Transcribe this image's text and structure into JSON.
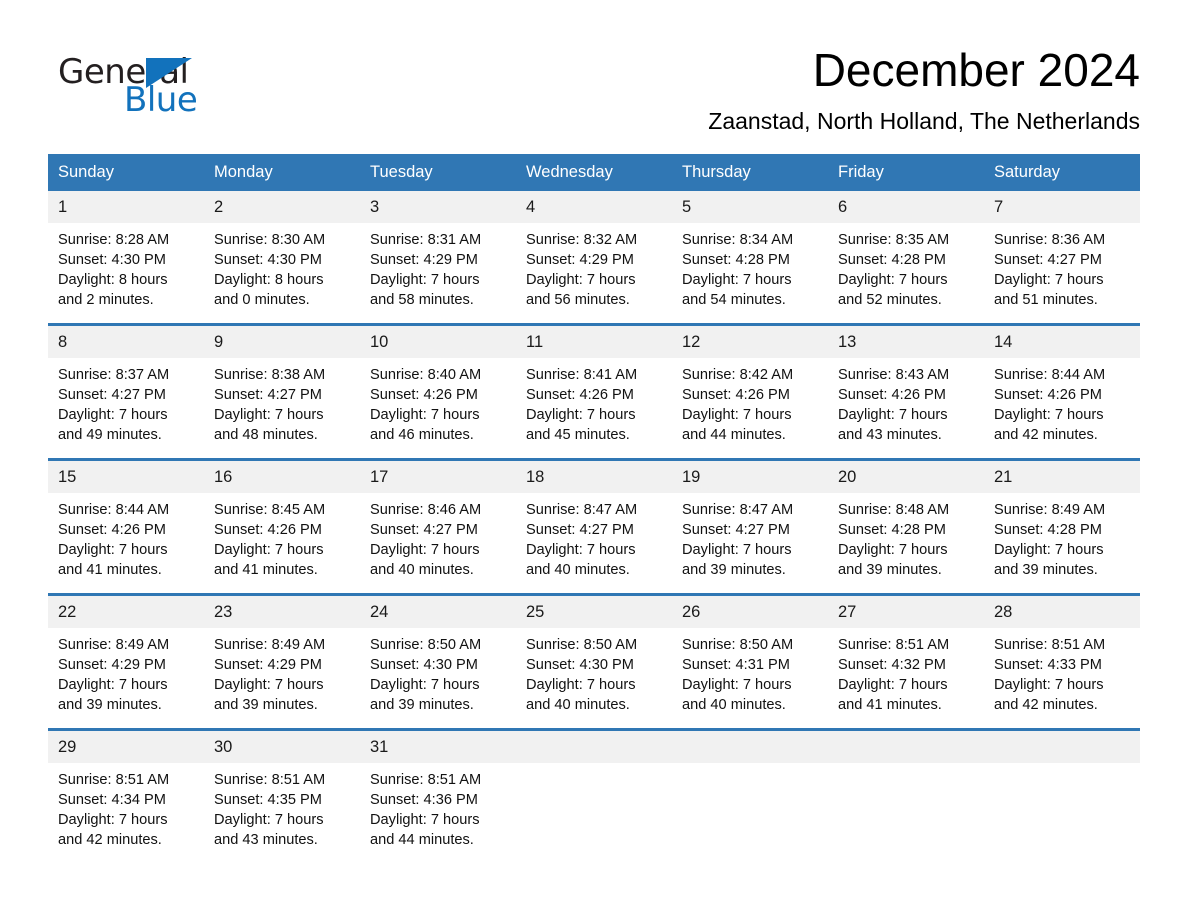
{
  "brand": {
    "name_part1": "General",
    "name_part2": "Blue",
    "triangle_color": "#1272bc"
  },
  "header": {
    "month_title": "December 2024",
    "location": "Zaanstad, North Holland, The Netherlands",
    "header_bg_color": "#3077b4",
    "daynum_bg_color": "#f1f1f1"
  },
  "weekdays": [
    "Sunday",
    "Monday",
    "Tuesday",
    "Wednesday",
    "Thursday",
    "Friday",
    "Saturday"
  ],
  "weeks": [
    [
      {
        "day": "1",
        "sunrise": "Sunrise: 8:28 AM",
        "sunset": "Sunset: 4:30 PM",
        "daylight_1": "Daylight: 8 hours",
        "daylight_2": "and 2 minutes."
      },
      {
        "day": "2",
        "sunrise": "Sunrise: 8:30 AM",
        "sunset": "Sunset: 4:30 PM",
        "daylight_1": "Daylight: 8 hours",
        "daylight_2": "and 0 minutes."
      },
      {
        "day": "3",
        "sunrise": "Sunrise: 8:31 AM",
        "sunset": "Sunset: 4:29 PM",
        "daylight_1": "Daylight: 7 hours",
        "daylight_2": "and 58 minutes."
      },
      {
        "day": "4",
        "sunrise": "Sunrise: 8:32 AM",
        "sunset": "Sunset: 4:29 PM",
        "daylight_1": "Daylight: 7 hours",
        "daylight_2": "and 56 minutes."
      },
      {
        "day": "5",
        "sunrise": "Sunrise: 8:34 AM",
        "sunset": "Sunset: 4:28 PM",
        "daylight_1": "Daylight: 7 hours",
        "daylight_2": "and 54 minutes."
      },
      {
        "day": "6",
        "sunrise": "Sunrise: 8:35 AM",
        "sunset": "Sunset: 4:28 PM",
        "daylight_1": "Daylight: 7 hours",
        "daylight_2": "and 52 minutes."
      },
      {
        "day": "7",
        "sunrise": "Sunrise: 8:36 AM",
        "sunset": "Sunset: 4:27 PM",
        "daylight_1": "Daylight: 7 hours",
        "daylight_2": "and 51 minutes."
      }
    ],
    [
      {
        "day": "8",
        "sunrise": "Sunrise: 8:37 AM",
        "sunset": "Sunset: 4:27 PM",
        "daylight_1": "Daylight: 7 hours",
        "daylight_2": "and 49 minutes."
      },
      {
        "day": "9",
        "sunrise": "Sunrise: 8:38 AM",
        "sunset": "Sunset: 4:27 PM",
        "daylight_1": "Daylight: 7 hours",
        "daylight_2": "and 48 minutes."
      },
      {
        "day": "10",
        "sunrise": "Sunrise: 8:40 AM",
        "sunset": "Sunset: 4:26 PM",
        "daylight_1": "Daylight: 7 hours",
        "daylight_2": "and 46 minutes."
      },
      {
        "day": "11",
        "sunrise": "Sunrise: 8:41 AM",
        "sunset": "Sunset: 4:26 PM",
        "daylight_1": "Daylight: 7 hours",
        "daylight_2": "and 45 minutes."
      },
      {
        "day": "12",
        "sunrise": "Sunrise: 8:42 AM",
        "sunset": "Sunset: 4:26 PM",
        "daylight_1": "Daylight: 7 hours",
        "daylight_2": "and 44 minutes."
      },
      {
        "day": "13",
        "sunrise": "Sunrise: 8:43 AM",
        "sunset": "Sunset: 4:26 PM",
        "daylight_1": "Daylight: 7 hours",
        "daylight_2": "and 43 minutes."
      },
      {
        "day": "14",
        "sunrise": "Sunrise: 8:44 AM",
        "sunset": "Sunset: 4:26 PM",
        "daylight_1": "Daylight: 7 hours",
        "daylight_2": "and 42 minutes."
      }
    ],
    [
      {
        "day": "15",
        "sunrise": "Sunrise: 8:44 AM",
        "sunset": "Sunset: 4:26 PM",
        "daylight_1": "Daylight: 7 hours",
        "daylight_2": "and 41 minutes."
      },
      {
        "day": "16",
        "sunrise": "Sunrise: 8:45 AM",
        "sunset": "Sunset: 4:26 PM",
        "daylight_1": "Daylight: 7 hours",
        "daylight_2": "and 41 minutes."
      },
      {
        "day": "17",
        "sunrise": "Sunrise: 8:46 AM",
        "sunset": "Sunset: 4:27 PM",
        "daylight_1": "Daylight: 7 hours",
        "daylight_2": "and 40 minutes."
      },
      {
        "day": "18",
        "sunrise": "Sunrise: 8:47 AM",
        "sunset": "Sunset: 4:27 PM",
        "daylight_1": "Daylight: 7 hours",
        "daylight_2": "and 40 minutes."
      },
      {
        "day": "19",
        "sunrise": "Sunrise: 8:47 AM",
        "sunset": "Sunset: 4:27 PM",
        "daylight_1": "Daylight: 7 hours",
        "daylight_2": "and 39 minutes."
      },
      {
        "day": "20",
        "sunrise": "Sunrise: 8:48 AM",
        "sunset": "Sunset: 4:28 PM",
        "daylight_1": "Daylight: 7 hours",
        "daylight_2": "and 39 minutes."
      },
      {
        "day": "21",
        "sunrise": "Sunrise: 8:49 AM",
        "sunset": "Sunset: 4:28 PM",
        "daylight_1": "Daylight: 7 hours",
        "daylight_2": "and 39 minutes."
      }
    ],
    [
      {
        "day": "22",
        "sunrise": "Sunrise: 8:49 AM",
        "sunset": "Sunset: 4:29 PM",
        "daylight_1": "Daylight: 7 hours",
        "daylight_2": "and 39 minutes."
      },
      {
        "day": "23",
        "sunrise": "Sunrise: 8:49 AM",
        "sunset": "Sunset: 4:29 PM",
        "daylight_1": "Daylight: 7 hours",
        "daylight_2": "and 39 minutes."
      },
      {
        "day": "24",
        "sunrise": "Sunrise: 8:50 AM",
        "sunset": "Sunset: 4:30 PM",
        "daylight_1": "Daylight: 7 hours",
        "daylight_2": "and 39 minutes."
      },
      {
        "day": "25",
        "sunrise": "Sunrise: 8:50 AM",
        "sunset": "Sunset: 4:30 PM",
        "daylight_1": "Daylight: 7 hours",
        "daylight_2": "and 40 minutes."
      },
      {
        "day": "26",
        "sunrise": "Sunrise: 8:50 AM",
        "sunset": "Sunset: 4:31 PM",
        "daylight_1": "Daylight: 7 hours",
        "daylight_2": "and 40 minutes."
      },
      {
        "day": "27",
        "sunrise": "Sunrise: 8:51 AM",
        "sunset": "Sunset: 4:32 PM",
        "daylight_1": "Daylight: 7 hours",
        "daylight_2": "and 41 minutes."
      },
      {
        "day": "28",
        "sunrise": "Sunrise: 8:51 AM",
        "sunset": "Sunset: 4:33 PM",
        "daylight_1": "Daylight: 7 hours",
        "daylight_2": "and 42 minutes."
      }
    ],
    [
      {
        "day": "29",
        "sunrise": "Sunrise: 8:51 AM",
        "sunset": "Sunset: 4:34 PM",
        "daylight_1": "Daylight: 7 hours",
        "daylight_2": "and 42 minutes."
      },
      {
        "day": "30",
        "sunrise": "Sunrise: 8:51 AM",
        "sunset": "Sunset: 4:35 PM",
        "daylight_1": "Daylight: 7 hours",
        "daylight_2": "and 43 minutes."
      },
      {
        "day": "31",
        "sunrise": "Sunrise: 8:51 AM",
        "sunset": "Sunset: 4:36 PM",
        "daylight_1": "Daylight: 7 hours",
        "daylight_2": "and 44 minutes."
      },
      {
        "day": "",
        "sunrise": "",
        "sunset": "",
        "daylight_1": "",
        "daylight_2": ""
      },
      {
        "day": "",
        "sunrise": "",
        "sunset": "",
        "daylight_1": "",
        "daylight_2": ""
      },
      {
        "day": "",
        "sunrise": "",
        "sunset": "",
        "daylight_1": "",
        "daylight_2": ""
      },
      {
        "day": "",
        "sunrise": "",
        "sunset": "",
        "daylight_1": "",
        "daylight_2": ""
      }
    ]
  ]
}
